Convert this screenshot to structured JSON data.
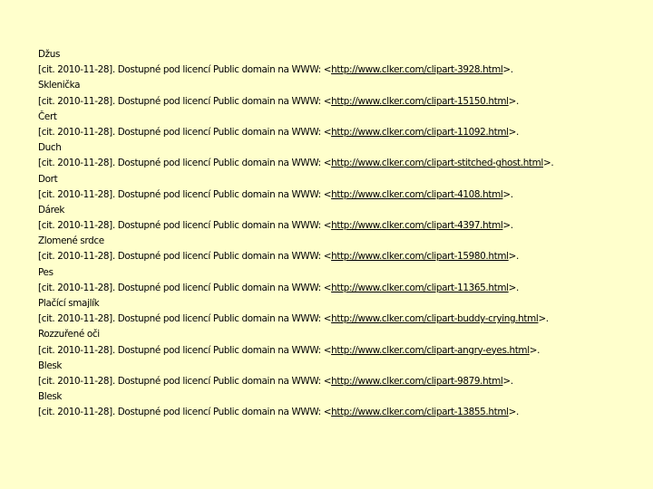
{
  "citation": {
    "prefix": "[cit. 2010-11-28]. Dostupné pod licencí Public domain na WWW: <",
    "suffix": ">."
  },
  "entries": [
    {
      "title": "Džus",
      "url": "http://www.clker.com/clipart-3928.html"
    },
    {
      "title": "Sklenička",
      "url": "http://www.clker.com/clipart-15150.html"
    },
    {
      "title": "Čert",
      "url": "http://www.clker.com/clipart-11092.html"
    },
    {
      "title": "Duch",
      "url": "http://www.clker.com/clipart-stitched-ghost.html"
    },
    {
      "title": "Dort",
      "url": "http://www.clker.com/clipart-4108.html"
    },
    {
      "title": "Dárek",
      "url": "http://www.clker.com/clipart-4397.html"
    },
    {
      "title": "Zlomené srdce",
      "url": "http://www.clker.com/clipart-15980.html"
    },
    {
      "title": "Pes",
      "url": "http://www.clker.com/clipart-11365.html"
    },
    {
      "title": "Plačící smajlík",
      "url": "http://www.clker.com/clipart-buddy-crying.html"
    },
    {
      "title": "Rozzuřené oči",
      "url": "http://www.clker.com/clipart-angry-eyes.html"
    },
    {
      "title": "Blesk",
      "url": "http://www.clker.com/clipart-9879.html"
    },
    {
      "title": "Blesk",
      "url": "http://www.clker.com/clipart-13855.html"
    }
  ]
}
